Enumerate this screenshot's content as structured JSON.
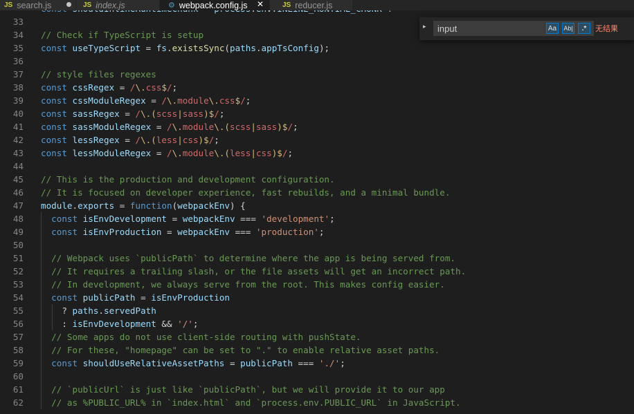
{
  "tabs": [
    {
      "label": "search.js",
      "icon": "js-icon",
      "icon_text": "JS",
      "state": "modified"
    },
    {
      "label": "index.js",
      "icon": "js-icon",
      "icon_text": "JS",
      "state": "italic"
    },
    {
      "label": "webpack.config.js",
      "icon": "config-icon",
      "icon_text": "⚙",
      "state": "active",
      "close": "✕"
    },
    {
      "label": "reducer.js",
      "icon": "js-icon",
      "icon_text": "JS",
      "state": "normal"
    }
  ],
  "find": {
    "value": "input",
    "match_case": "Aa",
    "whole_word": "Ab|",
    "regex": ".*",
    "result": "无结果",
    "toggle": "▸"
  },
  "lines": [
    {
      "n": "",
      "t": [
        [
          "c-kw",
          "const "
        ],
        [
          "c-var",
          "shouldInlineRuntimeChunk"
        ],
        [
          "c-op",
          " = "
        ],
        [
          "c-var",
          "process"
        ],
        [
          "c-op",
          "."
        ],
        [
          "c-var",
          "env"
        ],
        [
          "c-op",
          "."
        ],
        [
          "c-var",
          "INLINE_RUNTIME_CHUNK"
        ],
        [
          "c-op",
          " !== "
        ]
      ]
    },
    {
      "n": "33",
      "t": []
    },
    {
      "n": "34",
      "t": [
        [
          "c-com",
          "// Check if TypeScript is setup"
        ]
      ]
    },
    {
      "n": "35",
      "t": [
        [
          "c-kw",
          "const "
        ],
        [
          "c-var",
          "useTypeScript"
        ],
        [
          "c-op",
          " = "
        ],
        [
          "c-var",
          "fs"
        ],
        [
          "c-op",
          "."
        ],
        [
          "c-fn",
          "existsSync"
        ],
        [
          "c-op",
          "("
        ],
        [
          "c-var",
          "paths"
        ],
        [
          "c-op",
          "."
        ],
        [
          "c-var",
          "appTsConfig"
        ],
        [
          "c-op",
          ");"
        ]
      ]
    },
    {
      "n": "36",
      "t": []
    },
    {
      "n": "37",
      "t": [
        [
          "c-com",
          "// style files regexes"
        ]
      ]
    },
    {
      "n": "38",
      "t": [
        [
          "c-kw",
          "const "
        ],
        [
          "c-var",
          "cssRegex"
        ],
        [
          "c-op",
          " = "
        ],
        [
          "c-rx",
          "/"
        ],
        [
          "c-rxs",
          "\\."
        ],
        [
          "c-rx",
          "css"
        ],
        [
          "c-rxs",
          "$"
        ],
        [
          "c-rx",
          "/"
        ],
        [
          "c-op",
          ";"
        ]
      ]
    },
    {
      "n": "39",
      "t": [
        [
          "c-kw",
          "const "
        ],
        [
          "c-var",
          "cssModuleRegex"
        ],
        [
          "c-op",
          " = "
        ],
        [
          "c-rx",
          "/"
        ],
        [
          "c-rxs",
          "\\."
        ],
        [
          "c-rx",
          "module"
        ],
        [
          "c-rxs",
          "\\."
        ],
        [
          "c-rx",
          "css"
        ],
        [
          "c-rxs",
          "$"
        ],
        [
          "c-rx",
          "/"
        ],
        [
          "c-op",
          ";"
        ]
      ]
    },
    {
      "n": "40",
      "t": [
        [
          "c-kw",
          "const "
        ],
        [
          "c-var",
          "sassRegex"
        ],
        [
          "c-op",
          " = "
        ],
        [
          "c-rx",
          "/"
        ],
        [
          "c-rxs",
          "\\.("
        ],
        [
          "c-rx",
          "scss"
        ],
        [
          "c-rxs",
          "|"
        ],
        [
          "c-rx",
          "sass"
        ],
        [
          "c-rxs",
          ")$"
        ],
        [
          "c-rx",
          "/"
        ],
        [
          "c-op",
          ";"
        ]
      ]
    },
    {
      "n": "41",
      "t": [
        [
          "c-kw",
          "const "
        ],
        [
          "c-var",
          "sassModuleRegex"
        ],
        [
          "c-op",
          " = "
        ],
        [
          "c-rx",
          "/"
        ],
        [
          "c-rxs",
          "\\."
        ],
        [
          "c-rx",
          "module"
        ],
        [
          "c-rxs",
          "\\.("
        ],
        [
          "c-rx",
          "scss"
        ],
        [
          "c-rxs",
          "|"
        ],
        [
          "c-rx",
          "sass"
        ],
        [
          "c-rxs",
          ")$"
        ],
        [
          "c-rx",
          "/"
        ],
        [
          "c-op",
          ";"
        ]
      ]
    },
    {
      "n": "42",
      "t": [
        [
          "c-kw",
          "const "
        ],
        [
          "c-var",
          "lessRegex"
        ],
        [
          "c-op",
          " = "
        ],
        [
          "c-rx",
          "/"
        ],
        [
          "c-rxs",
          "\\.("
        ],
        [
          "c-rx",
          "less"
        ],
        [
          "c-rxs",
          "|"
        ],
        [
          "c-rx",
          "css"
        ],
        [
          "c-rxs",
          ")$"
        ],
        [
          "c-rx",
          "/"
        ],
        [
          "c-op",
          ";"
        ]
      ]
    },
    {
      "n": "43",
      "t": [
        [
          "c-kw",
          "const "
        ],
        [
          "c-var",
          "lessModuleRegex"
        ],
        [
          "c-op",
          " = "
        ],
        [
          "c-rx",
          "/"
        ],
        [
          "c-rxs",
          "\\."
        ],
        [
          "c-rx",
          "module"
        ],
        [
          "c-rxs",
          "\\.("
        ],
        [
          "c-rx",
          "less"
        ],
        [
          "c-rxs",
          "|"
        ],
        [
          "c-rx",
          "css"
        ],
        [
          "c-rxs",
          ")$"
        ],
        [
          "c-rx",
          "/"
        ],
        [
          "c-op",
          ";"
        ]
      ]
    },
    {
      "n": "44",
      "t": []
    },
    {
      "n": "45",
      "t": [
        [
          "c-com",
          "// This is the production and development configuration."
        ]
      ]
    },
    {
      "n": "46",
      "t": [
        [
          "c-com",
          "// It is focused on developer experience, fast rebuilds, and a minimal bundle."
        ]
      ]
    },
    {
      "n": "47",
      "t": [
        [
          "c-var",
          "module"
        ],
        [
          "c-op",
          "."
        ],
        [
          "c-var",
          "exports"
        ],
        [
          "c-op",
          " = "
        ],
        [
          "c-kw",
          "function"
        ],
        [
          "c-op",
          "("
        ],
        [
          "c-var",
          "webpackEnv"
        ],
        [
          "c-op",
          ") {"
        ]
      ]
    },
    {
      "n": "48",
      "t": [
        [
          "c-op",
          "  "
        ],
        [
          "c-kw",
          "const "
        ],
        [
          "c-var",
          "isEnvDevelopment"
        ],
        [
          "c-op",
          " = "
        ],
        [
          "c-var",
          "webpackEnv"
        ],
        [
          "c-op",
          " === "
        ],
        [
          "c-str",
          "'development'"
        ],
        [
          "c-op",
          ";"
        ]
      ]
    },
    {
      "n": "49",
      "t": [
        [
          "c-op",
          "  "
        ],
        [
          "c-kw",
          "const "
        ],
        [
          "c-var",
          "isEnvProduction"
        ],
        [
          "c-op",
          " = "
        ],
        [
          "c-var",
          "webpackEnv"
        ],
        [
          "c-op",
          " === "
        ],
        [
          "c-str",
          "'production'"
        ],
        [
          "c-op",
          ";"
        ]
      ]
    },
    {
      "n": "50",
      "t": []
    },
    {
      "n": "51",
      "t": [
        [
          "c-op",
          "  "
        ],
        [
          "c-com",
          "// Webpack uses `publicPath` to determine where the app is being served from."
        ]
      ]
    },
    {
      "n": "52",
      "t": [
        [
          "c-op",
          "  "
        ],
        [
          "c-com",
          "// It requires a trailing slash, or the file assets will get an incorrect path."
        ]
      ]
    },
    {
      "n": "53",
      "t": [
        [
          "c-op",
          "  "
        ],
        [
          "c-com",
          "// In development, we always serve from the root. This makes config easier."
        ]
      ]
    },
    {
      "n": "54",
      "t": [
        [
          "c-op",
          "  "
        ],
        [
          "c-kw",
          "const "
        ],
        [
          "c-var",
          "publicPath"
        ],
        [
          "c-op",
          " = "
        ],
        [
          "c-var",
          "isEnvProduction"
        ]
      ]
    },
    {
      "n": "55",
      "t": [
        [
          "c-op",
          "    ? "
        ],
        [
          "c-var",
          "paths"
        ],
        [
          "c-op",
          "."
        ],
        [
          "c-var",
          "servedPath"
        ]
      ]
    },
    {
      "n": "56",
      "t": [
        [
          "c-op",
          "    : "
        ],
        [
          "c-var",
          "isEnvDevelopment"
        ],
        [
          "c-op",
          " && "
        ],
        [
          "c-str",
          "'/'"
        ],
        [
          "c-op",
          ";"
        ]
      ]
    },
    {
      "n": "57",
      "t": [
        [
          "c-op",
          "  "
        ],
        [
          "c-com",
          "// Some apps do not use client-side routing with pushState."
        ]
      ]
    },
    {
      "n": "58",
      "t": [
        [
          "c-op",
          "  "
        ],
        [
          "c-com",
          "// For these, \"homepage\" can be set to \".\" to enable relative asset paths."
        ]
      ]
    },
    {
      "n": "59",
      "t": [
        [
          "c-op",
          "  "
        ],
        [
          "c-kw",
          "const "
        ],
        [
          "c-var",
          "shouldUseRelativeAssetPaths"
        ],
        [
          "c-op",
          " = "
        ],
        [
          "c-var",
          "publicPath"
        ],
        [
          "c-op",
          " === "
        ],
        [
          "c-str",
          "'./'"
        ],
        [
          "c-op",
          ";"
        ]
      ]
    },
    {
      "n": "60",
      "t": []
    },
    {
      "n": "61",
      "t": [
        [
          "c-op",
          "  "
        ],
        [
          "c-com",
          "// `publicUrl` is just like `publicPath`, but we will provide it to our app"
        ]
      ]
    },
    {
      "n": "62",
      "t": [
        [
          "c-op",
          "  "
        ],
        [
          "c-com",
          "// as %PUBLIC_URL% in `index.html` and `process.env.PUBLIC_URL` in JavaScript."
        ]
      ]
    }
  ]
}
